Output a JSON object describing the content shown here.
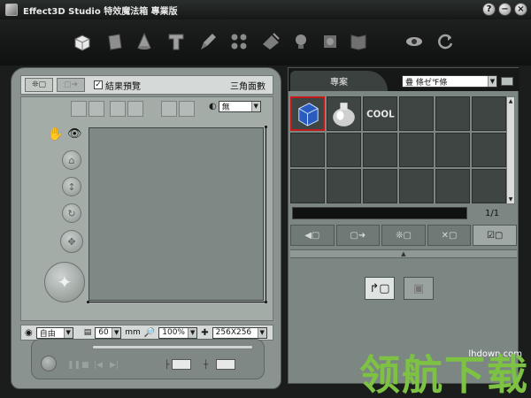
{
  "window": {
    "title": "Effect3D Studio 特效魔法箱 專業版",
    "help_label": "?",
    "minimize_label": "−",
    "close_label": "×"
  },
  "toolbar": {
    "icons": [
      "cube-open-icon",
      "panel-icon",
      "cone-icon",
      "text-3d-icon",
      "paint-brush-icon",
      "dots-icon",
      "tools-icon",
      "bulb-icon",
      "gear-box-icon",
      "book-icon",
      "eye-tool-icon",
      "refresh-icon"
    ]
  },
  "left_panel": {
    "preview_checkbox_label": "結果預覽",
    "preview_checked": true,
    "polygon_label": "三角面數",
    "shading_select": "無",
    "render_mode_select": "自由",
    "size_value": "60",
    "size_unit": "mm",
    "zoom_value": "100%",
    "resolution_value": "256X256"
  },
  "right_panel": {
    "tab_label": "專案",
    "category_select": "疊  條ゼ℉條",
    "page_indicator": "1/1",
    "thumbnails": [
      "blue-cube-thumbnail",
      "silver-vase-thumbnail",
      "cool-text-thumbnail"
    ]
  },
  "watermark": {
    "text": "领航下载",
    "url": "lhdown.com"
  },
  "colors": {
    "panel_gray": "#8a938f",
    "dark_bg": "#1a1d1c",
    "selection_red": "#c21a1a",
    "watermark_green": "#7dc243"
  }
}
